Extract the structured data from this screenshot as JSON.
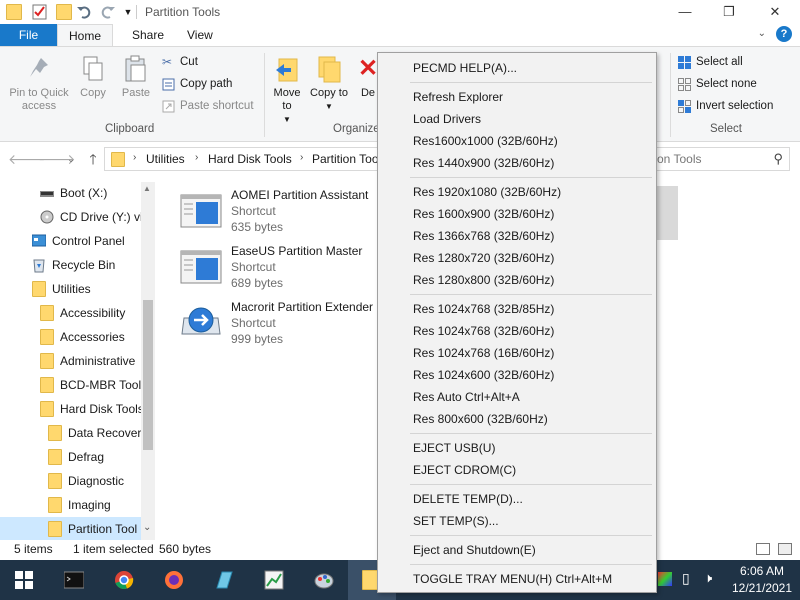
{
  "window": {
    "title": "Partition Tools",
    "minimize": "—",
    "maximize": "❐",
    "close": "✕"
  },
  "ribbon": {
    "tabs": [
      "File",
      "Home",
      "Share",
      "View"
    ],
    "help": "?",
    "clipboard": {
      "pin_label": "Pin to Quick access",
      "copy_label": "Copy",
      "paste_label": "Paste",
      "cut_label": "Cut",
      "copy_path_label": "Copy path",
      "paste_shortcut_label": "Paste shortcut",
      "group_label": "Clipboard"
    },
    "organize": {
      "move_to_label": "Move to",
      "copy_to_label": "Copy to",
      "delete_label": "De",
      "group_label": "Organize"
    },
    "select": {
      "select_all": "Select all",
      "select_none": "Select none",
      "invert_selection": "Invert selection",
      "group_label": "Select"
    }
  },
  "address": {
    "breadcrumbs": [
      "Utilities",
      "Hard Disk Tools",
      "Partition Too"
    ],
    "search_placeholder": "tion Tools"
  },
  "nav": {
    "items": [
      {
        "label": "Boot (X:)",
        "icon": "drive-icon"
      },
      {
        "label": "CD Drive (Y:) vi",
        "icon": "cd-drive-icon"
      },
      {
        "label": "Control Panel",
        "icon": "control-panel-icon"
      },
      {
        "label": "Recycle Bin",
        "icon": "recycle-bin-icon"
      },
      {
        "label": "Utilities",
        "icon": "folder-icon"
      },
      {
        "label": "Accessibility",
        "icon": "folder-icon"
      },
      {
        "label": "Accessories",
        "icon": "folder-icon"
      },
      {
        "label": "Administrative",
        "icon": "folder-icon"
      },
      {
        "label": "BCD-MBR Tool",
        "icon": "folder-icon"
      },
      {
        "label": "Hard Disk Tools",
        "icon": "folder-icon"
      },
      {
        "label": "Data Recover",
        "icon": "folder-icon"
      },
      {
        "label": "Defrag",
        "icon": "folder-icon"
      },
      {
        "label": "Diagnostic",
        "icon": "folder-icon"
      },
      {
        "label": "Imaging",
        "icon": "folder-icon"
      },
      {
        "label": "Partition Tool",
        "icon": "folder-icon"
      }
    ]
  },
  "files": [
    {
      "name": "AOMEI Partition Assistant",
      "type": "Shortcut",
      "size": "635 bytes"
    },
    {
      "name": "EaseUS Partition Master",
      "type": "Shortcut",
      "size": "689 bytes"
    },
    {
      "name": "Macrorit Partition Extender",
      "type": "Shortcut",
      "size": "999 bytes"
    }
  ],
  "status": {
    "items": "5 items",
    "selected": "1 item selected",
    "size": "560 bytes"
  },
  "context_menu": {
    "items": [
      "PECMD HELP(A)...",
      "Refresh Explorer",
      "Load Drivers",
      "Res1600x1000 (32B/60Hz)",
      "Res 1440x900 (32B/60Hz)",
      "Res 1920x1080 (32B/60Hz)",
      "Res 1600x900 (32B/60Hz)",
      "Res 1366x768 (32B/60Hz)",
      "Res 1280x720 (32B/60Hz)",
      "Res 1280x800 (32B/60Hz)",
      "Res 1024x768 (32B/85Hz)",
      "Res 1024x768 (32B/60Hz)",
      "Res 1024x768 (16B/60Hz)",
      "Res 1024x600 (32B/60Hz)",
      "Res Auto Ctrl+Alt+A",
      "Res 800x600 (32B/60Hz)",
      "EJECT USB(U)",
      "EJECT CDROM(C)",
      "DELETE TEMP(D)...",
      "SET TEMP(S)...",
      "Eject and Shutdown(E)",
      "TOGGLE TRAY MENU(H) Ctrl+Alt+M"
    ]
  },
  "taskbar": {
    "time": "6:06 AM",
    "date": "12/21/2021"
  },
  "colors": {
    "accent": "#1979ca",
    "taskbar": "#1f3346",
    "selection": "#cde8ff",
    "folder": "#ffd86e"
  }
}
